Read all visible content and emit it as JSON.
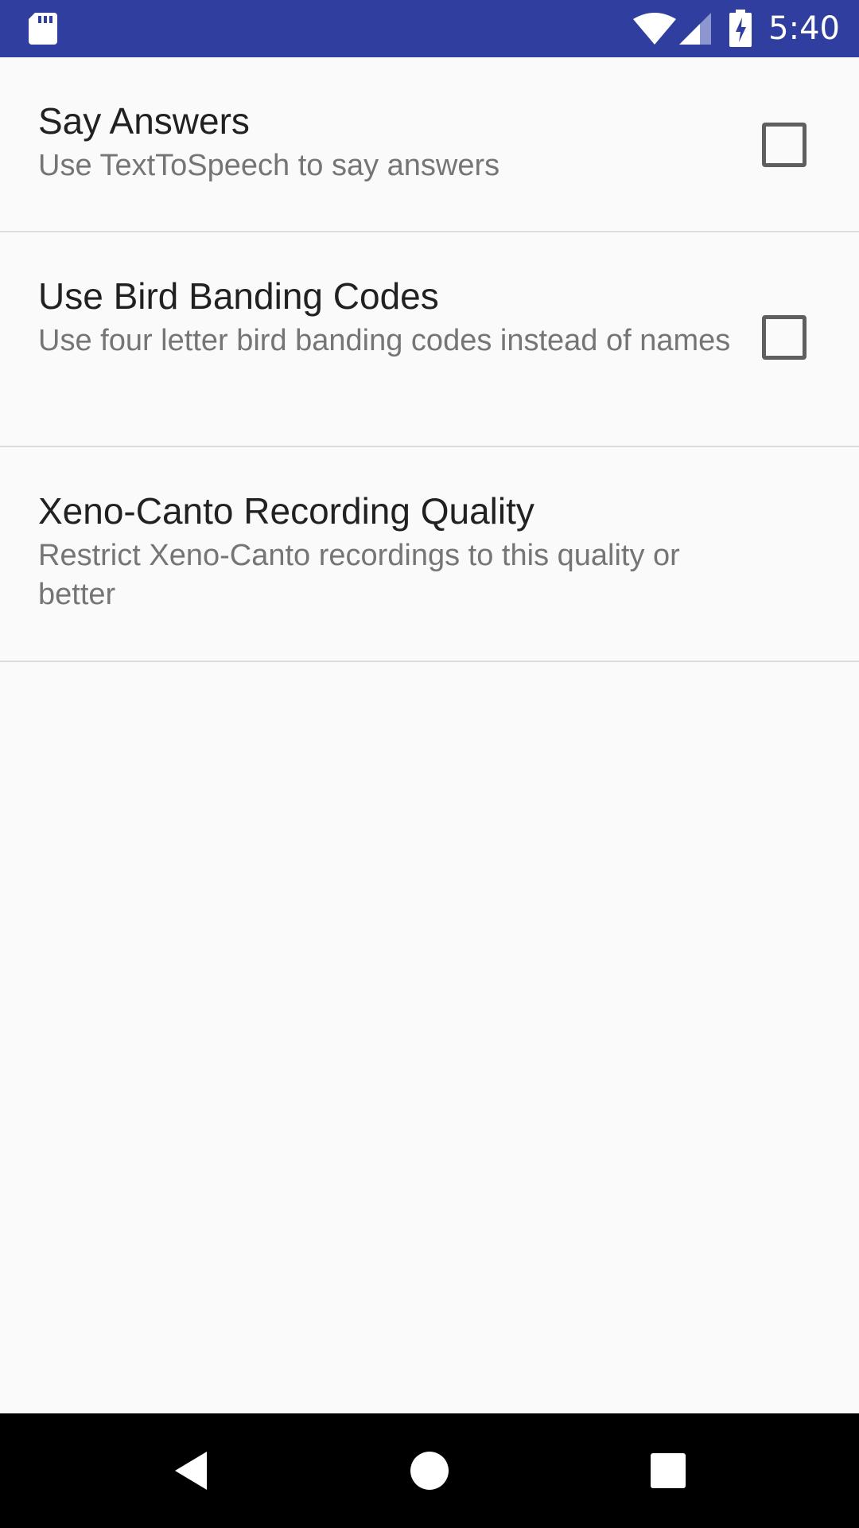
{
  "status_bar": {
    "time": "5:40",
    "icons": [
      "sd-card-icon",
      "wifi-icon",
      "signal-icon",
      "battery-charging-icon"
    ],
    "background": "#303f9f"
  },
  "preferences": [
    {
      "title": "Say Answers",
      "summary": "Use TextToSpeech to say answers",
      "has_checkbox": true,
      "checked": false
    },
    {
      "title": "Use Bird Banding Codes",
      "summary": "Use four letter bird banding codes instead of names",
      "has_checkbox": true,
      "checked": false
    },
    {
      "title": "Xeno-Canto Recording Quality",
      "summary": "Restrict Xeno-Canto recordings to this quality or better",
      "has_checkbox": false
    }
  ],
  "nav_bar": {
    "buttons": [
      "back-icon",
      "home-icon",
      "recents-icon"
    ]
  }
}
